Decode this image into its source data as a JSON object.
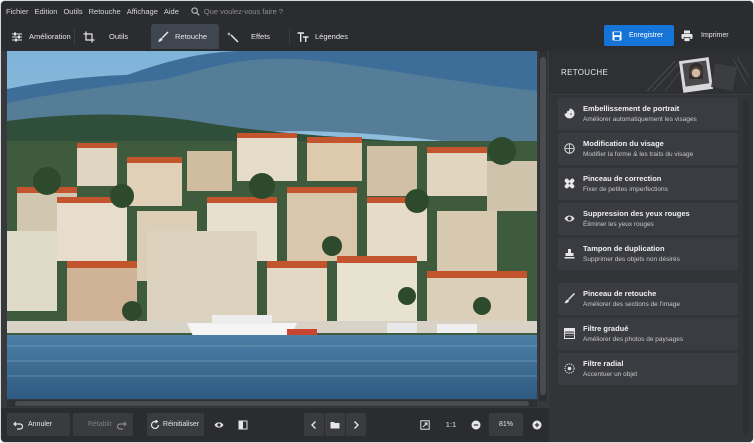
{
  "menubar": {
    "items": [
      "Fichier",
      "Edition",
      "Outils",
      "Retouche",
      "Affichage",
      "Aide"
    ],
    "search_placeholder": "Que voulez-vous faire ?"
  },
  "toolbar": {
    "tabs": [
      {
        "label": "Amélioration",
        "icon": "sliders-icon"
      },
      {
        "label": "Outils",
        "icon": "crop-icon"
      },
      {
        "label": "Retouche",
        "icon": "brush-icon",
        "active": true
      },
      {
        "label": "Effets",
        "icon": "magic-wand-icon"
      },
      {
        "label": "Légendes",
        "icon": "text-icon"
      }
    ],
    "save_label": "Enregistrer",
    "print_label": "Imprimer",
    "accent_color": "#1674d9"
  },
  "panel": {
    "title": "RETOUCHE",
    "tools": [
      {
        "title": "Embellissement de portrait",
        "subtitle": "Améliorer automatiquement les visages",
        "icon": "portrait-magic-icon"
      },
      {
        "title": "Modification du visage",
        "subtitle": "Modifier la forme & les traits du visage",
        "icon": "face-outline-icon"
      },
      {
        "title": "Pinceau de correction",
        "subtitle": "Fixer de petites imperfections",
        "icon": "bandage-icon"
      },
      {
        "title": "Suppression des yeux rouges",
        "subtitle": "Éliminer les yeux rouges",
        "icon": "eye-icon"
      },
      {
        "title": "Tampon de duplication",
        "subtitle": "Supprimer des objets non désirés",
        "icon": "stamp-icon"
      },
      {
        "title": "Pinceau de retouche",
        "subtitle": "Améliorer des sections de l'image",
        "icon": "brush-icon"
      },
      {
        "title": "Filtre gradué",
        "subtitle": "Améliorer des photos de paysages",
        "icon": "gradient-icon"
      },
      {
        "title": "Filtre radial",
        "subtitle": "Accentuer un objet",
        "icon": "radial-icon"
      }
    ]
  },
  "bottombar": {
    "undo_label": "Annuler",
    "redo_label": "Rétablir",
    "reset_label": "Réinitialiser",
    "actual_size_label": "1:1",
    "zoom_value": "81%"
  }
}
